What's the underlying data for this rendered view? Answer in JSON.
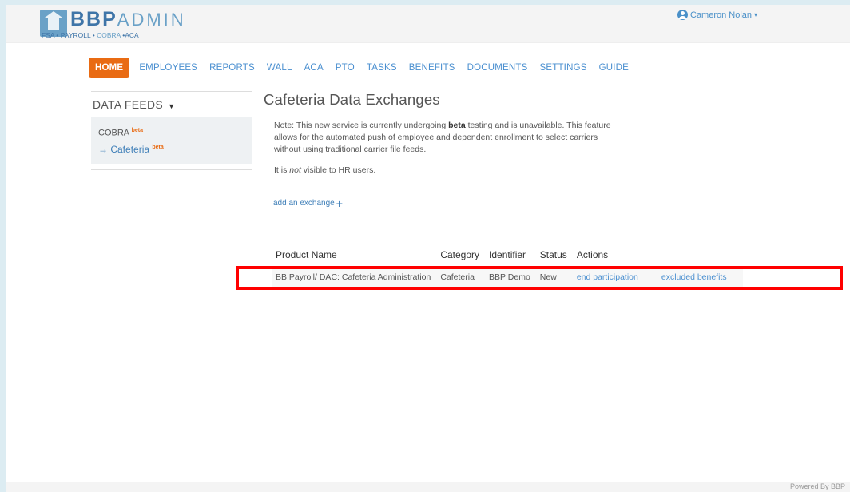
{
  "logo": {
    "brand_bold": "BBP",
    "brand_light": "ADMIN",
    "tagline_prefix": "FSA • PAYROLL • ",
    "tagline_cobra": "COBRA",
    "tagline_suffix": " •ACA"
  },
  "user": {
    "name": "Cameron Nolan",
    "caret": "▾"
  },
  "nav": {
    "items": [
      "HOME",
      "EMPLOYEES",
      "REPORTS",
      "WALL",
      "ACA",
      "PTO",
      "TASKS",
      "BENEFITS",
      "DOCUMENTS",
      "SETTINGS",
      "GUIDE"
    ],
    "active": "HOME"
  },
  "sidebar": {
    "heading": "DATA FEEDS",
    "heading_caret": "▼",
    "items": [
      {
        "label": "COBRA",
        "badge": "beta"
      },
      {
        "arrow": "→",
        "label": "Cafeteria",
        "badge": "beta"
      }
    ]
  },
  "main": {
    "title": "Cafeteria Data Exchanges",
    "note_pre": "Note: This new service is currently undergoing ",
    "note_bold": "beta",
    "note_post": " testing and is unavailable. This feature allows for the automated push of employee and dependent enrollment to select carriers without using traditional carrier file feeds.",
    "hr_pre": "It is ",
    "hr_em": "not",
    "hr_post": " visible to HR users.",
    "add_link": "add an exchange"
  },
  "table": {
    "headers": [
      "Product Name",
      "Category",
      "Identifier",
      "Status",
      "Actions"
    ],
    "rows": [
      {
        "product": "BB Payroll/ DAC: Cafeteria Administration",
        "category": "Cafeteria",
        "identifier": "BBP Demo",
        "status": "New",
        "action_1": "end participation",
        "action_2": "excluded benefits"
      }
    ]
  },
  "footer": {
    "powered": "Powered By BBP"
  },
  "colors": {
    "accent": "#e96b13",
    "link": "#4a8fd0",
    "highlight": "#ff0000",
    "frame": "#dcecf2"
  }
}
